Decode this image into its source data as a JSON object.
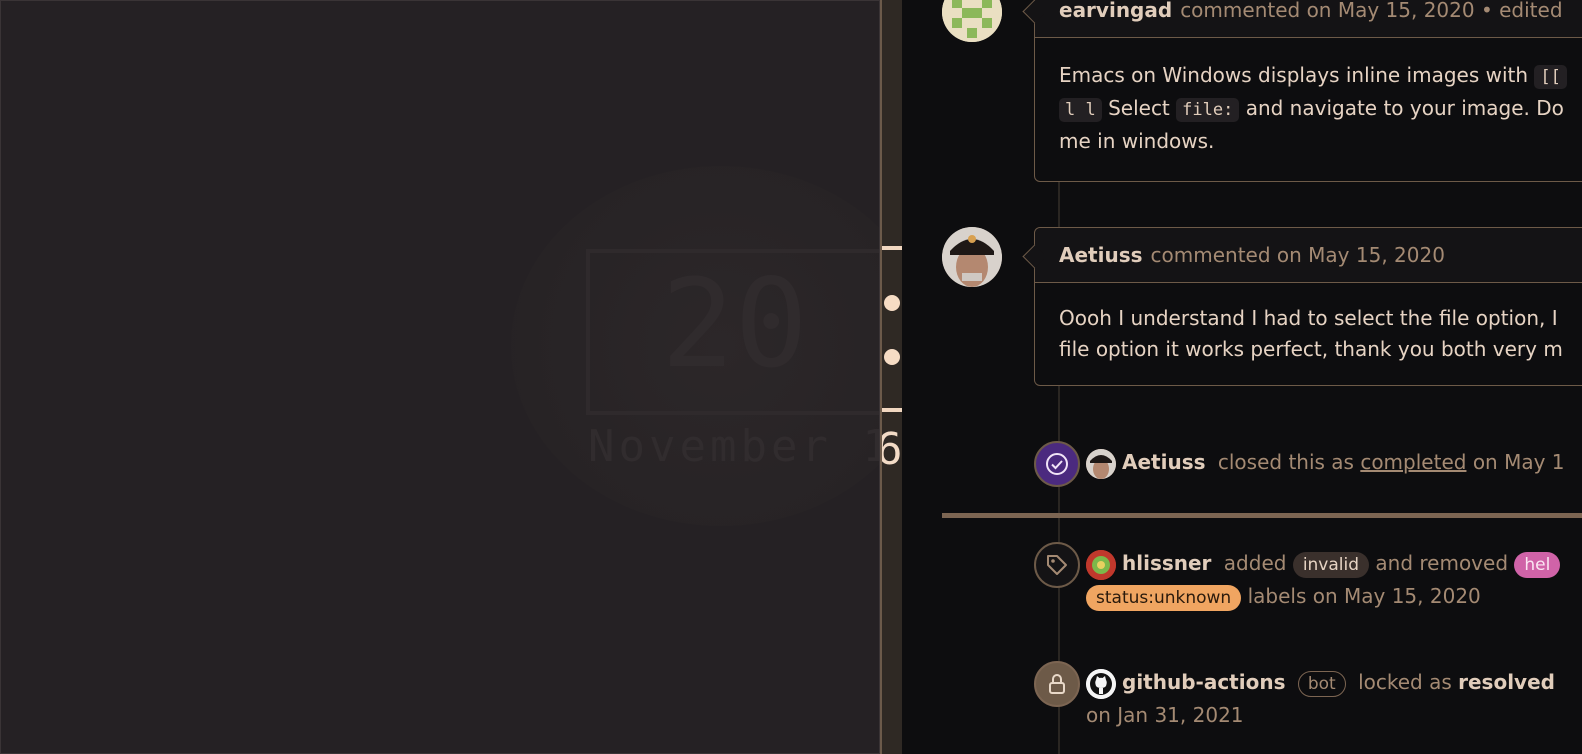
{
  "wallpaper": {
    "clock_time": "20",
    "clock_date": "November 16"
  },
  "sidebar_bar": {
    "digit": "6"
  },
  "comments": [
    {
      "author": "earvingad",
      "meta": "commented on May 15, 2020 • edited",
      "body_line1_prefix": "Emacs on Windows displays inline images with",
      "body_code1": "[[",
      "body_code2": "l l",
      "body_line2_middle": "Select",
      "body_code3": "file:",
      "body_line2_suffix": "and navigate to your image. Do",
      "body_line3": "me in windows."
    },
    {
      "author": "Aetiuss",
      "meta": "commented on May 15, 2020",
      "body_line1": "Oooh I understand I had to select the file option, I",
      "body_line2": "file option it works perfect, thank you both very m"
    }
  ],
  "events": {
    "closed": {
      "author": "Aetiuss",
      "text_before": "closed this as",
      "link": "completed",
      "text_after": "on May 1"
    },
    "labeled": {
      "author": "hlissner",
      "added": "added",
      "label_added": "invalid",
      "removed": "and removed",
      "label_removed": "hel",
      "label_status": "status:unknown",
      "text_after": "labels on May 15, 2020"
    },
    "locked": {
      "author": "github-actions",
      "badge": "bot",
      "text": "locked as",
      "reason": "resolved",
      "date": "on Jan 31, 2021"
    }
  },
  "colors": {
    "accent": "#a48a73",
    "closed_icon_bg": "#4b2a7f",
    "label_invalid": "#3a302c",
    "label_help": "#d063a8",
    "label_status": "#f0a561"
  },
  "icons": [
    "check-circle-icon",
    "tag-icon",
    "lock-icon",
    "github-icon"
  ]
}
